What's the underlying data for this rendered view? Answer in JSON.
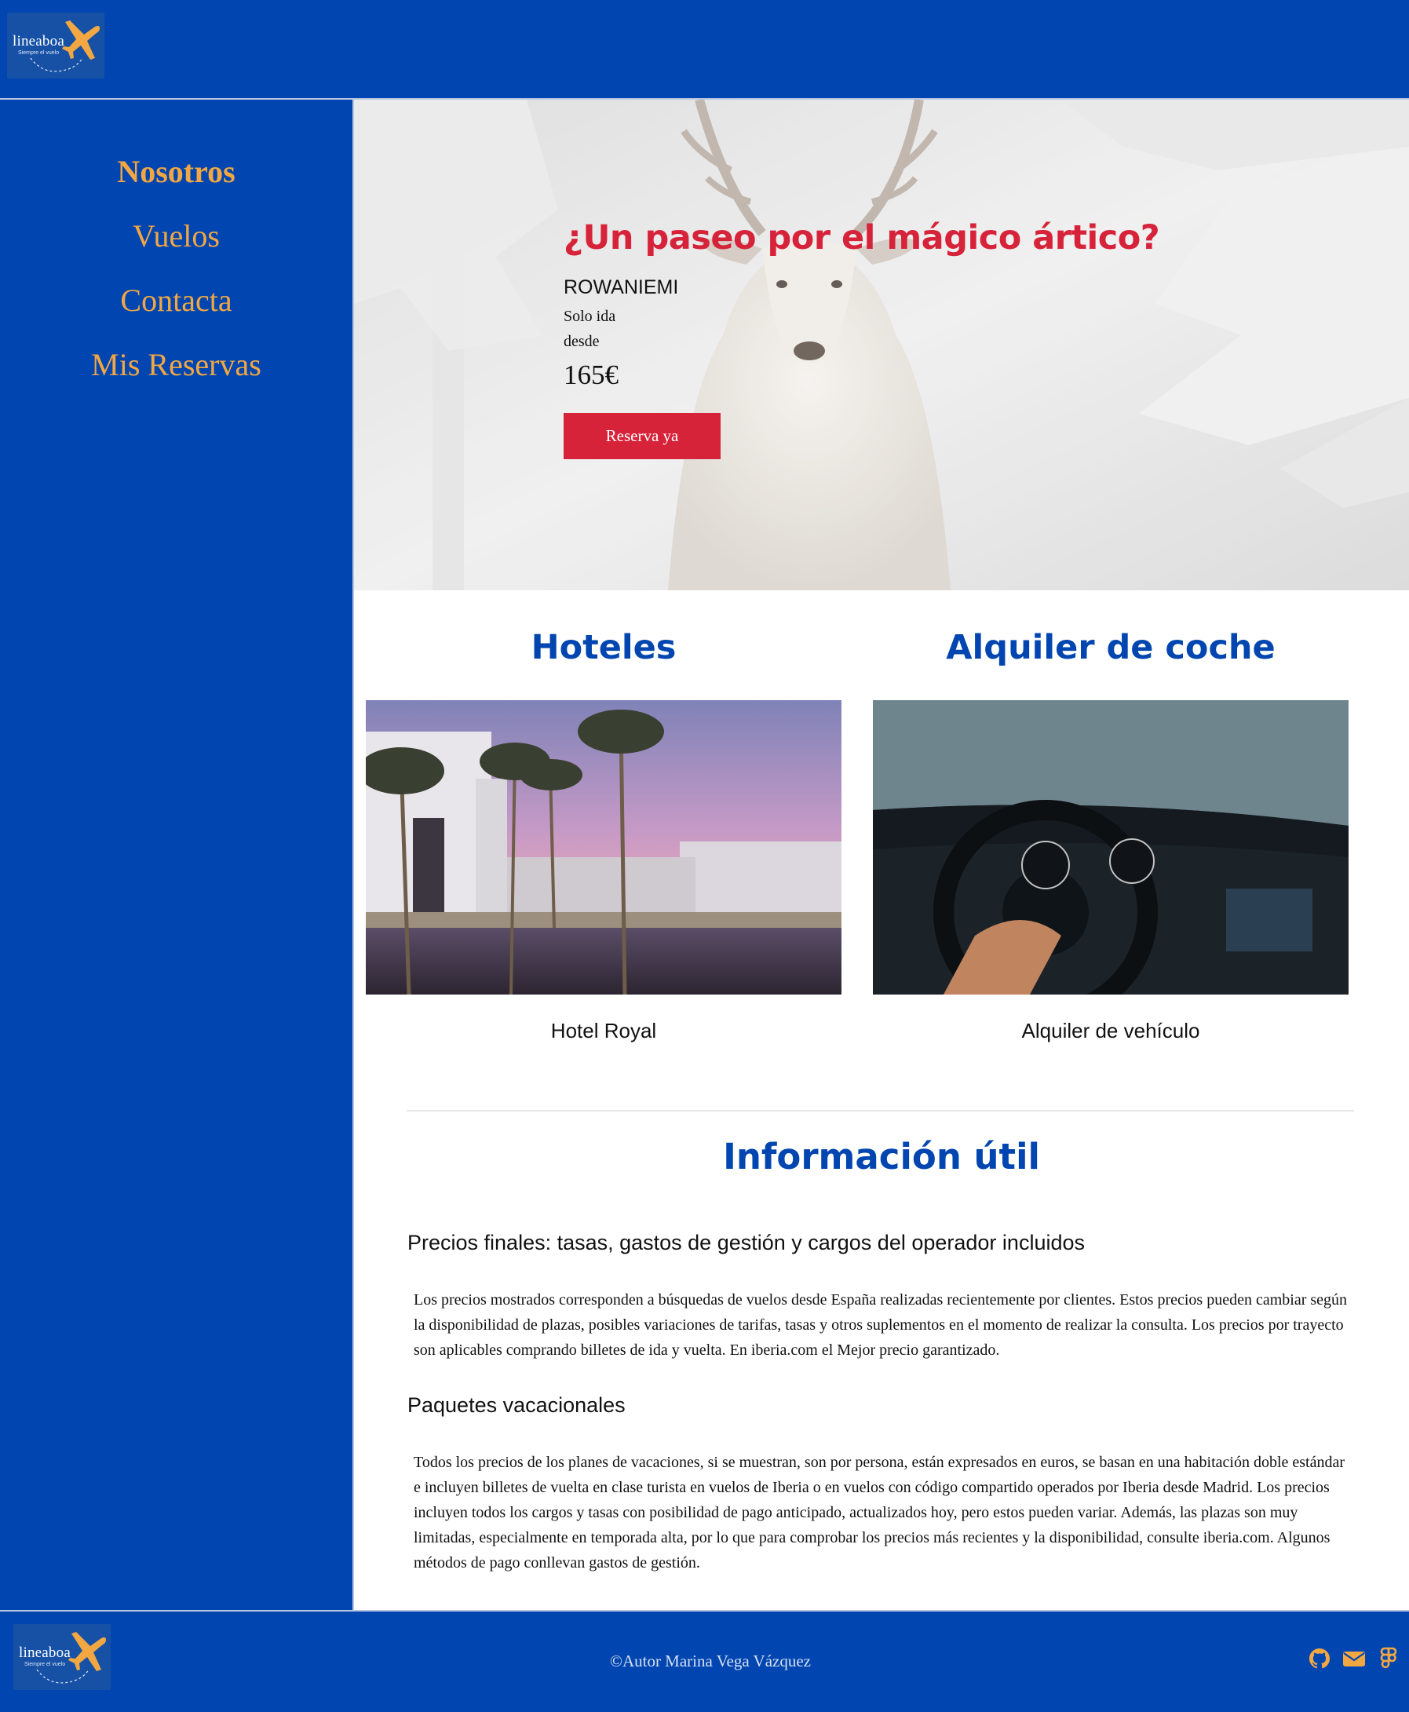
{
  "header": {
    "logo": {
      "brand": "lineaboa",
      "tagline": "Siempre el vuelo"
    }
  },
  "nav": {
    "items": [
      "Nosotros",
      "Vuelos",
      "Contacta",
      "Mis Reservas"
    ]
  },
  "hero": {
    "title": "¿Un paseo por el mágico ártico?",
    "city": "ROWANIEMI",
    "trip_type": "Solo ida",
    "from_label": "desde",
    "price": "165€",
    "button_label": "Reserva ya"
  },
  "cards": [
    {
      "section_title": "Hoteles",
      "caption": "Hotel Royal"
    },
    {
      "section_title": "Alquiler de coche",
      "caption": "Alquiler de vehículo"
    }
  ],
  "info": {
    "title": "Información útil",
    "blocks": [
      {
        "heading": "Precios finales: tasas, gastos de gestión y cargos del operador incluidos",
        "body": "Los precios mostrados corresponden a búsquedas de vuelos desde España realizadas recientemente por clientes. Estos precios pueden cambiar según la disponibilidad de plazas, posibles variaciones de tarifas, tasas y otros suplementos en el momento de realizar la consulta. Los precios por trayecto son aplicables comprando billetes de ida y vuelta. En iberia.com el Mejor precio garantizado."
      },
      {
        "heading": "Paquetes vacacionales",
        "body": "Todos los precios de los planes de vacaciones, si se muestran, son por persona, están expresados en euros, se basan en una habitación doble estándar e incluyen billetes de vuelta en clase turista en vuelos de Iberia o en vuelos con código compartido operados por Iberia desde Madrid. Los precios incluyen todos los cargos y tasas con posibilidad de pago anticipado, actualizados hoy, pero estos pueden variar. Además, las plazas son muy limitadas, especialmente en temporada alta, por lo que para comprobar los precios más recientes y la disponibilidad, consulte iberia.com. Algunos métodos de pago conllevan gastos de gestión."
      }
    ]
  },
  "footer": {
    "copyright": "©Autor Marina Vega Vázquez",
    "icons": [
      "github-icon",
      "email-icon",
      "figma-icon"
    ]
  },
  "colors": {
    "brand_blue": "#0146B0",
    "accent_orange": "#F2A743",
    "cta_red": "#D7233A"
  }
}
